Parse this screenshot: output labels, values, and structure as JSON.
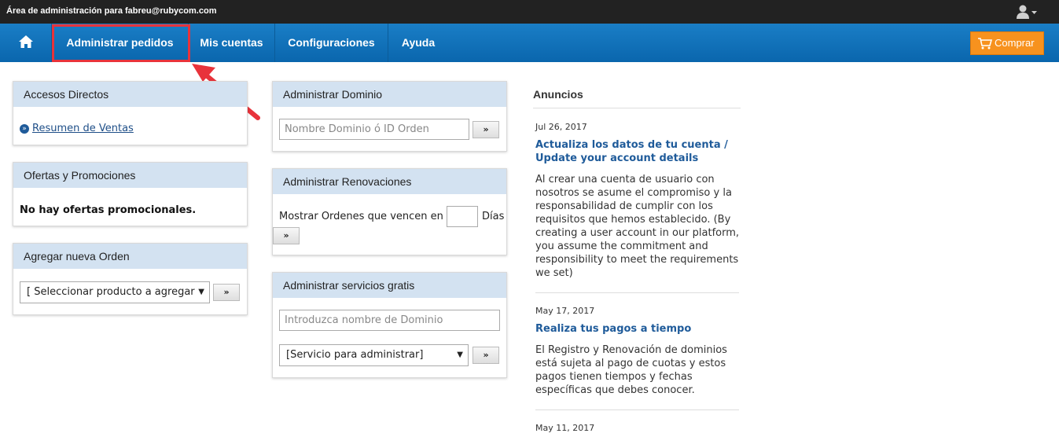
{
  "topbar": {
    "title": "Área de administración para fabreu@rubycom.com",
    "user_icon": "user-icon"
  },
  "nav": {
    "home_icon": "home-icon",
    "items": [
      {
        "label": "Administrar pedidos"
      },
      {
        "label": "Mis cuentas"
      },
      {
        "label": "Configuraciones"
      },
      {
        "label": "Ayuda"
      }
    ],
    "buy_label": "Comprar",
    "buy_icon": "cart-icon"
  },
  "colors": {
    "topbar": "#222222",
    "nav": "#0a66ad",
    "panel_header": "#d3e2f1",
    "buy_button": "#f7921e",
    "highlight": "#e8333b",
    "link": "#1f5b9a"
  },
  "accesos": {
    "title": "Accesos Directos",
    "link": "Resumen de Ventas"
  },
  "ofertas": {
    "title": "Ofertas y Promociones",
    "message": "No hay ofertas promocionales."
  },
  "agregar": {
    "title": "Agregar nueva Orden",
    "select_value": "[ Seleccionar producto a agregar ]",
    "go": "»"
  },
  "dominio": {
    "title": "Administrar Dominio",
    "placeholder": "Nombre Dominio ó ID Orden",
    "go": "»"
  },
  "renovaciones": {
    "title": "Administrar Renovaciones",
    "label": "Mostrar Ordenes que vencen en",
    "suffix": "Días",
    "go": "»"
  },
  "gratis": {
    "title": "Administrar servicios gratis",
    "placeholder": "Introduzca nombre de Dominio",
    "select_value": "[Servicio para administrar]",
    "go": "»"
  },
  "anuncios": {
    "title": "Anuncios",
    "items": [
      {
        "date": "Jul 26, 2017",
        "headline": "Actualiza los datos de tu cuenta / Update your account details",
        "body": "Al crear una cuenta de usuario con nosotros se asume el compromiso y la responsabilidad de cumplir con los requisitos que hemos establecido. (By creating a user account in our platform, you assume the commitment and responsibility to meet the requirements we set)"
      },
      {
        "date": "May 17, 2017",
        "headline": "Realiza tus pagos a tiempo",
        "body": "El Registro y Renovación de dominios está sujeta al pago de cuotas y estos pagos tienen tiempos y fechas específicas que debes conocer."
      },
      {
        "date": "May 11, 2017"
      }
    ]
  }
}
